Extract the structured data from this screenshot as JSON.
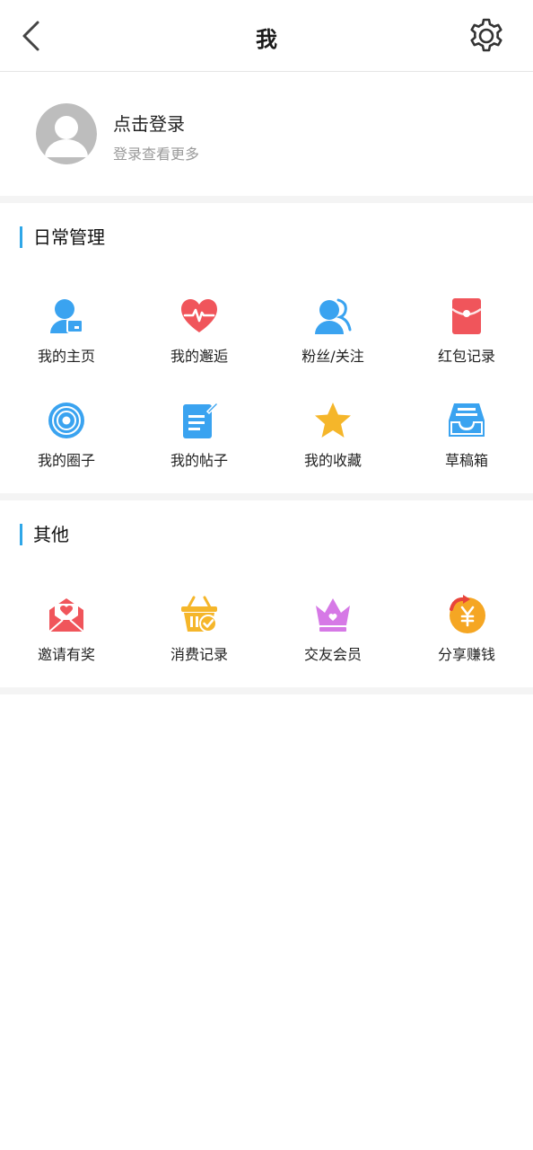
{
  "header": {
    "title": "我"
  },
  "profile": {
    "title": "点击登录",
    "subtitle": "登录查看更多"
  },
  "daily": {
    "title": "日常管理",
    "items": [
      {
        "label": "我的主页",
        "icon": "user-card-icon",
        "color": "#3aa3f0"
      },
      {
        "label": "我的邂逅",
        "icon": "heartbeat-icon",
        "color": "#f0555b"
      },
      {
        "label": "粉丝/关注",
        "icon": "users-icon",
        "color": "#3aa3f0"
      },
      {
        "label": "红包记录",
        "icon": "red-envelope-icon",
        "color": "#f0555b"
      },
      {
        "label": "我的圈子",
        "icon": "circle-target-icon",
        "color": "#3aa3f0"
      },
      {
        "label": "我的帖子",
        "icon": "edit-document-icon",
        "color": "#3aa3f0"
      },
      {
        "label": "我的收藏",
        "icon": "star-icon",
        "color": "#f5b62a"
      },
      {
        "label": "草稿箱",
        "icon": "inbox-tray-icon",
        "color": "#3aa3f0"
      }
    ]
  },
  "other": {
    "title": "其他",
    "items": [
      {
        "label": "邀请有奖",
        "icon": "invite-envelope-icon",
        "color": "#f0555b"
      },
      {
        "label": "消费记录",
        "icon": "shopping-basket-icon",
        "color": "#f5b62a"
      },
      {
        "label": "交友会员",
        "icon": "crown-icon",
        "color": "#d679e6"
      },
      {
        "label": "分享赚钱",
        "icon": "yuan-coin-share-icon",
        "color": "#f5a623"
      }
    ]
  },
  "colors": {
    "accent": "#2fa7e8",
    "divider": "#f4f4f4"
  }
}
